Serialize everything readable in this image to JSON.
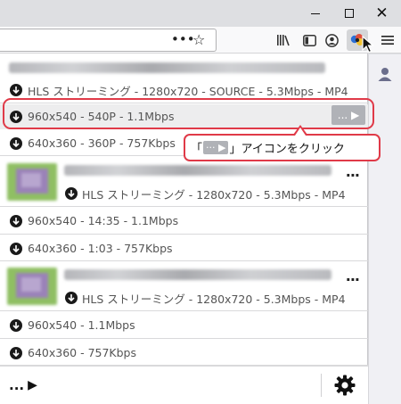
{
  "window": {
    "minimize_icon": "minimize-icon",
    "maximize_icon": "maximize-icon",
    "close_glyph": "✕"
  },
  "toolbar": {
    "url_dots": "•••",
    "star_glyph": "☆",
    "icons": [
      "library-icon",
      "sidebar-icon",
      "account-icon",
      "extension-icon",
      "menu-icon"
    ]
  },
  "popup": {
    "groups": [
      {
        "title_blurred": true,
        "main_row": "HLS ストリーミング - 1280x720 - SOURCE - 5.3Mbps - MP4",
        "sub_rows": [
          "960x540 - 540P - 1.1Mbps",
          "640x360 - 360P - 757Kbps"
        ]
      },
      {
        "title_blurred": true,
        "main_row": "HLS ストリーミング - 1280x720 - 5.3Mbps - MP4",
        "sub_rows": [
          "960x540 - 14:35 - 1.1Mbps",
          "640x360 - 1:03 - 757Kbps"
        ]
      },
      {
        "title_blurred": true,
        "main_row": "HLS ストリーミング - 1280x720 - 5.3Mbps - MP4",
        "sub_rows": [
          "960x540 - 1.1Mbps",
          "640x360 - 757Kbps"
        ]
      }
    ],
    "row_more_label": "...",
    "selected_button_label": "... ▶",
    "footer_more_label": "...",
    "footer_play_glyph": "▶"
  },
  "callout": {
    "open_bracket": "「",
    "chip_text": "··· ▶",
    "close_text": "」アイコンをクリック"
  },
  "colors": {
    "accent_red": "#e03a48",
    "selected_button": "#b0b2b7",
    "thumb_green": "#8fbf63",
    "thumb_purple": "#9a82b8"
  }
}
